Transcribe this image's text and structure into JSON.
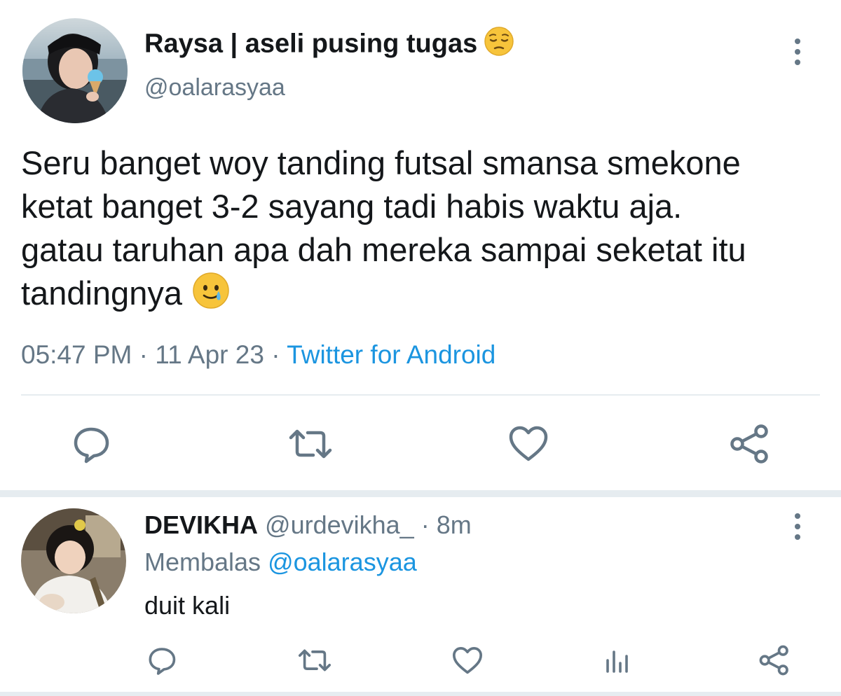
{
  "main_tweet": {
    "display_name": "Raysa | aseli pusing tugas",
    "display_name_emoji": "pensive-face-emoji",
    "handle": "@oalarasyaa",
    "text_lines": [
      "Seru banget woy tanding futsal smansa smekone",
      "ketat banget 3-2 sayang tadi habis waktu aja.",
      "gatau taruhan apa dah mereka sampai seketat itu",
      "tandingnya"
    ],
    "text_emoji": "smiling-face-with-tear-emoji",
    "time": "05:47 PM",
    "date": "11 Apr 23",
    "source": "Twitter for Android",
    "separator": "·"
  },
  "reply": {
    "display_name": "DEVIKHA",
    "handle": "@urdevikha_",
    "age": "8m",
    "replying_to_prefix": "Membalas",
    "replying_to_handle": "@oalarasyaa",
    "text": "duit kali"
  },
  "icons": {
    "reply": "speech-bubble-icon",
    "retweet": "retweet-icon",
    "like": "heart-icon",
    "share": "share-icon",
    "analytics": "analytics-icon",
    "more": "kebab-menu-icon"
  },
  "colors": {
    "text": "#14171a",
    "secondary": "#657786",
    "link": "#1b95e0",
    "divider": "#e6ecf0"
  }
}
